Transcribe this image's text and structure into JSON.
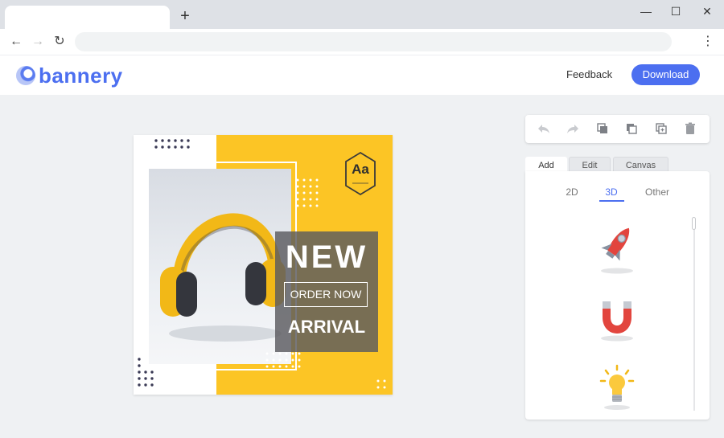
{
  "browser": {
    "new_tab_glyph": "+",
    "minimize_glyph": "—",
    "maximize_glyph": "☐",
    "close_glyph": "✕",
    "back_glyph": "←",
    "forward_glyph": "→",
    "reload_glyph": "↻",
    "menu_glyph": "⋮",
    "address_value": ""
  },
  "header": {
    "logo_text": "bannery",
    "feedback_label": "Feedback",
    "download_label": "Download",
    "accent_color": "#4c6ff0"
  },
  "banner": {
    "headline": "NEW",
    "cta": "ORDER NOW",
    "subline": "ARRIVAL",
    "badge_text": "Aa",
    "yellow_color": "#fcc525",
    "product_icon": "headphones-icon"
  },
  "toolbar": {
    "icons": [
      "undo-icon",
      "redo-icon",
      "bring-forward-icon",
      "send-backward-icon",
      "duplicate-icon",
      "delete-icon"
    ]
  },
  "panel": {
    "tabs": [
      {
        "label": "Add",
        "active": true
      },
      {
        "label": "Edit",
        "active": false
      },
      {
        "label": "Canvas",
        "active": false
      }
    ],
    "subtabs": [
      {
        "label": "2D",
        "active": false
      },
      {
        "label": "3D",
        "active": true
      },
      {
        "label": "Other",
        "active": false
      }
    ],
    "assets": [
      "rocket-icon",
      "magnet-icon",
      "lightbulb-icon"
    ]
  }
}
